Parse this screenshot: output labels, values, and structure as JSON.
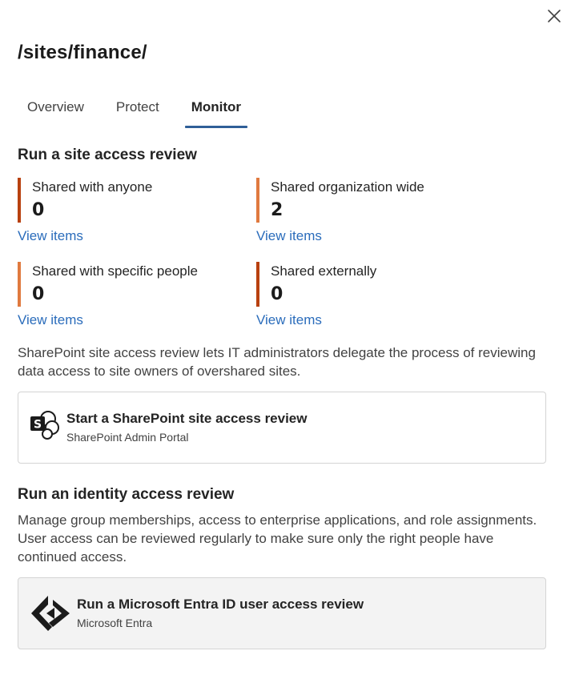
{
  "panel": {
    "title": "/sites/finance/",
    "close_icon": "close-icon"
  },
  "tabs": [
    {
      "label": "Overview",
      "active": false
    },
    {
      "label": "Protect",
      "active": false
    },
    {
      "label": "Monitor",
      "active": true
    }
  ],
  "site_review": {
    "heading": "Run a site access review",
    "stats": [
      {
        "label": "Shared with anyone",
        "value": "0",
        "link": "View items",
        "bar_color": "#b8410f"
      },
      {
        "label": "Shared organization wide",
        "value": "2",
        "link": "View items",
        "bar_color": "#e07a3f"
      },
      {
        "label": "Shared with specific people",
        "value": "0",
        "link": "View items",
        "bar_color": "#e07a3f"
      },
      {
        "label": "Shared externally",
        "value": "0",
        "link": "View items",
        "bar_color": "#b8410f"
      }
    ],
    "description": "SharePoint site access review lets IT administrators delegate the process of reviewing data access to site owners of overshared sites.",
    "card": {
      "title": "Start a SharePoint site access review",
      "subtitle": "SharePoint Admin Portal",
      "icon": "sharepoint-icon"
    }
  },
  "identity_review": {
    "heading": "Run an identity access review",
    "description": "Manage group memberships, access to enterprise applications, and role assignments. User access can be reviewed regularly to make sure only the right people have continued access.",
    "card": {
      "title": "Run a Microsoft Entra ID user access review",
      "subtitle": "Microsoft Entra",
      "icon": "entra-icon"
    }
  },
  "colors": {
    "accent": "#2f5f98",
    "link": "#2a6cbb",
    "bar_dark": "#b8410f",
    "bar_light": "#e07a3f"
  }
}
